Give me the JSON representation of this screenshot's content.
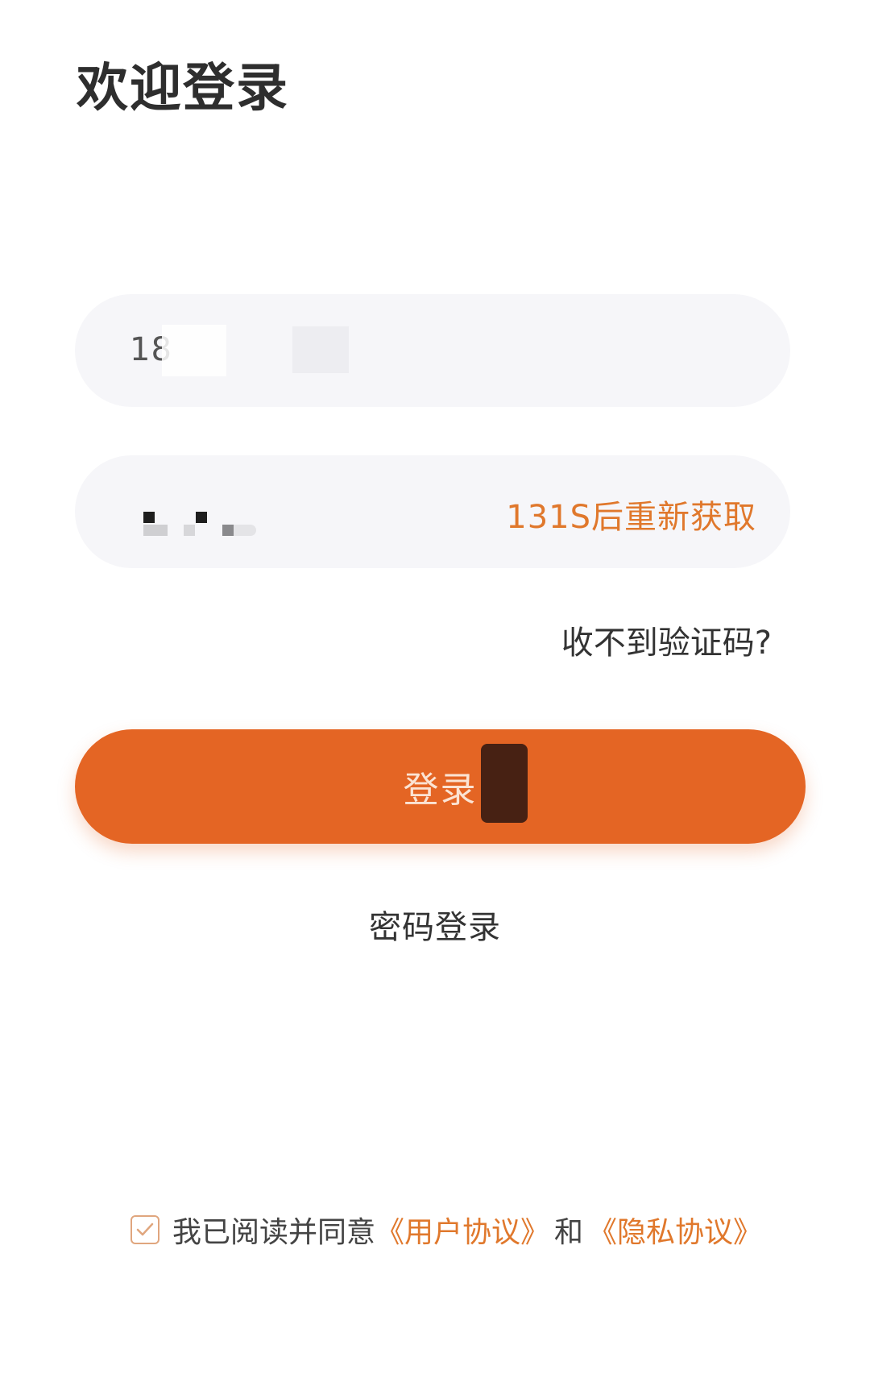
{
  "header": {
    "title": "欢迎登录"
  },
  "form": {
    "phone_value": "18",
    "code_resend_label": "131S后重新获取",
    "help_link": "收不到验证码?"
  },
  "actions": {
    "login_label": "登录",
    "password_login_label": "密码登录"
  },
  "agreement": {
    "checked": true,
    "prefix": "我已阅读并同意",
    "user_agreement": "《用户协议》",
    "conjunction": "和",
    "privacy_agreement": "《隐私协议》"
  },
  "colors": {
    "accent": "#e46524",
    "link": "#e0782c",
    "field_bg": "#f6f6f9"
  },
  "icons": {
    "checkbox": "checkmark-icon"
  }
}
